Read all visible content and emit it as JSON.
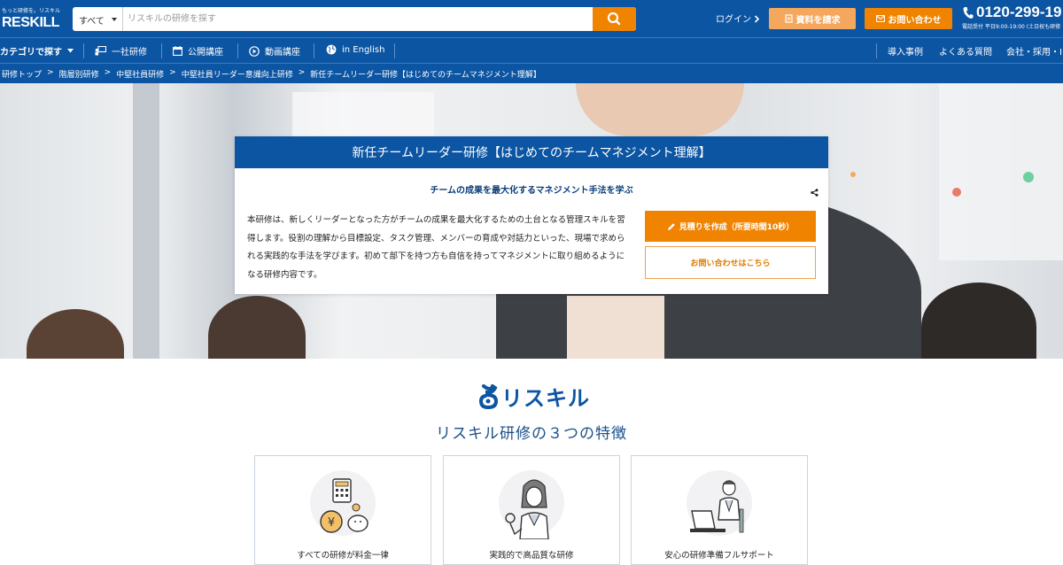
{
  "header": {
    "logo_tagline": "もっと研修を。リスキル",
    "logo_text": "RESKILL",
    "search_category": "すべて",
    "search_placeholder": "リスキルの研修を探す",
    "login_label": "ログイン",
    "request_docs_label": "資料を請求",
    "inquiry_label": "お問い合わせ",
    "phone_number": "0120-299-19",
    "phone_hours": "電話受付 平日9:00-19:00 (土日祝も研修"
  },
  "nav": {
    "category_label": "カテゴリで探す",
    "items": [
      "一社研修",
      "公開講座",
      "動画講座",
      "in English"
    ],
    "right_items": [
      "導入事例",
      "よくある質問",
      "会社・採用・IR"
    ]
  },
  "breadcrumb": [
    "研修トップ",
    "階層別研修",
    "中堅社員研修",
    "中堅社員リーダー意識向上研修",
    "新任チームリーダー研修【はじめてのチームマネジメント理解】"
  ],
  "breadcrumb_separator": ">",
  "course": {
    "title": "新任チームリーダー研修【はじめてのチームマネジメント理解】",
    "subtitle": "チームの成果を最大化するマネジメント手法を学ぶ",
    "description": "本研修は、新しくリーダーとなった方がチームの成果を最大化するための土台となる管理スキルを習得します。役割の理解から目標設定、タスク管理、メンバーの育成や対話力といった、現場で求められる実践的な手法を学びます。初めて部下を持つ方も自信を持ってマネジメントに取り組めるようになる研修内容です。",
    "estimate_button": "見積りを作成（所要時間10秒）",
    "contact_button": "お問い合わせはこちら"
  },
  "brand_text": "リスキル",
  "features": {
    "title": "リスキル研修の３つの特徴",
    "items": [
      {
        "label": "すべての研修が料金一律",
        "icon": "calculator-coin-piggybank-icon"
      },
      {
        "label": "実践的で高品質な研修",
        "icon": "instructor-ok-gesture-icon"
      },
      {
        "label": "安心の研修準備フルサポート",
        "icon": "support-staff-laptop-icon"
      }
    ]
  },
  "colors": {
    "primary": "#0c55a3",
    "accent": "#f08300",
    "accent_light": "#f5a85d"
  }
}
